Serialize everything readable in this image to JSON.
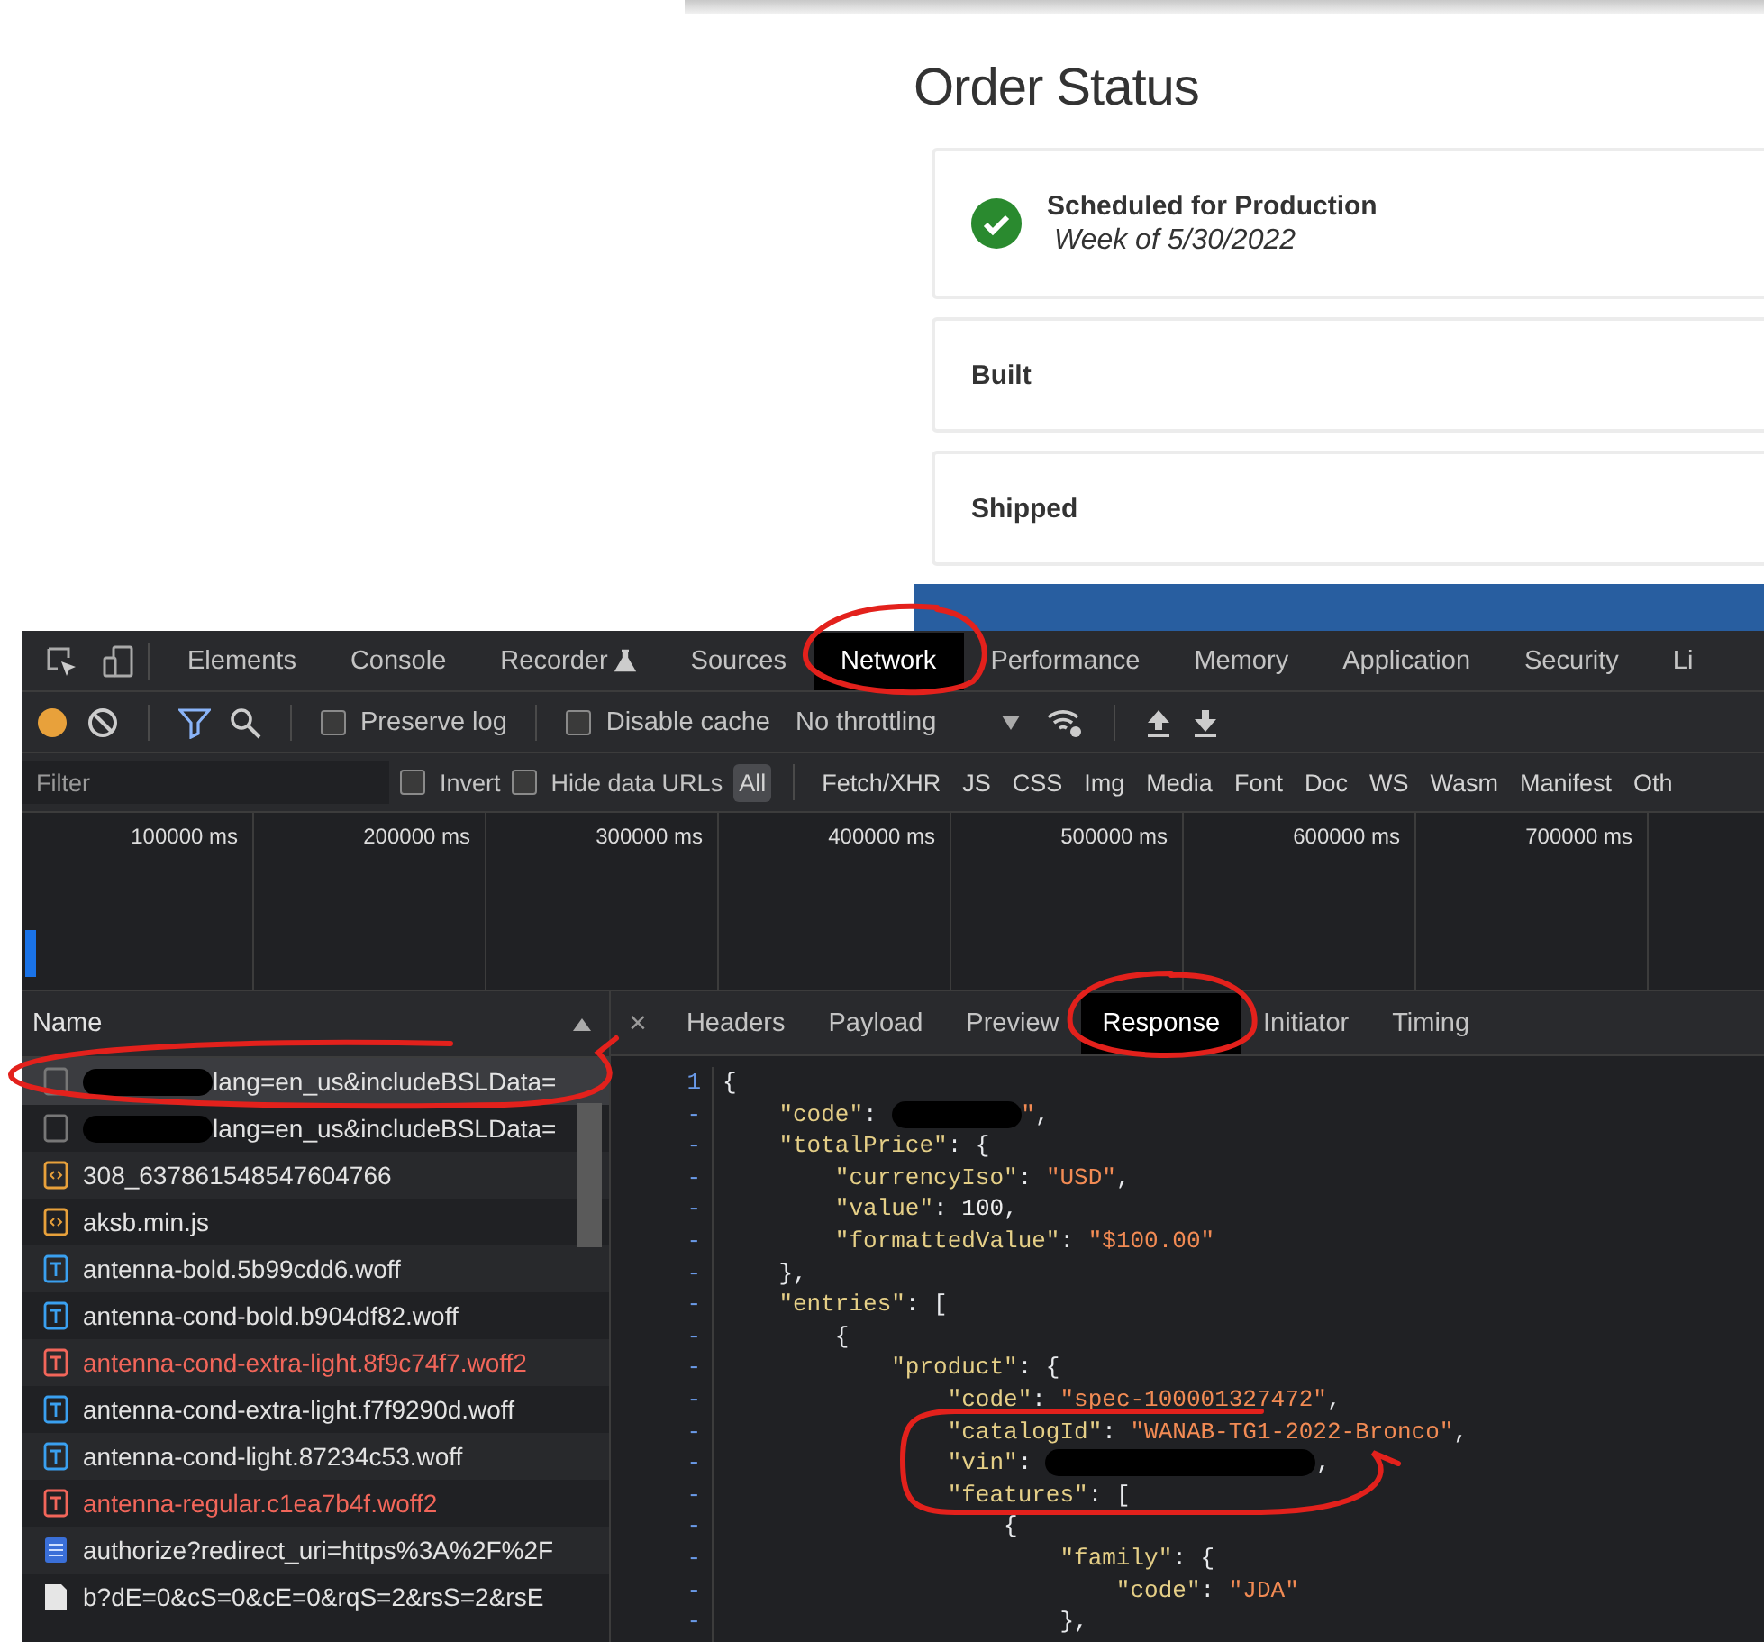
{
  "order_status": {
    "title": "Order Status",
    "steps": [
      {
        "label": "Scheduled for Production",
        "detail": "Week of 5/30/2022",
        "done": true
      },
      {
        "label": "Built",
        "done": false
      },
      {
        "label": "Shipped",
        "done": false
      }
    ]
  },
  "devtools": {
    "panels": [
      {
        "label": "Elements",
        "selected": false
      },
      {
        "label": "Console",
        "selected": false
      },
      {
        "label": "Recorder",
        "selected": false,
        "experimental": true
      },
      {
        "label": "Sources",
        "selected": false
      },
      {
        "label": "Network",
        "selected": true
      },
      {
        "label": "Performance",
        "selected": false
      },
      {
        "label": "Memory",
        "selected": false
      },
      {
        "label": "Application",
        "selected": false
      },
      {
        "label": "Security",
        "selected": false
      },
      {
        "label": "Li",
        "selected": false
      }
    ],
    "toolbar": {
      "preserve_log": {
        "label": "Preserve log",
        "checked": false
      },
      "disable_cache": {
        "label": "Disable cache",
        "checked": false
      },
      "throttling": "No throttling"
    },
    "filter": {
      "placeholder": "Filter",
      "invert": {
        "label": "Invert",
        "checked": false
      },
      "hide_data_urls": {
        "label": "Hide data URLs",
        "checked": false
      },
      "types": [
        {
          "label": "All",
          "selected": true
        },
        {
          "label": "Fetch/XHR",
          "selected": false
        },
        {
          "label": "JS",
          "selected": false
        },
        {
          "label": "CSS",
          "selected": false
        },
        {
          "label": "Img",
          "selected": false
        },
        {
          "label": "Media",
          "selected": false
        },
        {
          "label": "Font",
          "selected": false
        },
        {
          "label": "Doc",
          "selected": false
        },
        {
          "label": "WS",
          "selected": false
        },
        {
          "label": "Wasm",
          "selected": false
        },
        {
          "label": "Manifest",
          "selected": false
        },
        {
          "label": "Oth",
          "selected": false
        }
      ]
    },
    "timeline": [
      "100000 ms",
      "200000 ms",
      "300000 ms",
      "400000 ms",
      "500000 ms",
      "600000 ms",
      "700000 ms"
    ],
    "requests": {
      "column": "Name",
      "rows": [
        {
          "name": "lang=en_us&includeBSLData=",
          "kind": "blank",
          "redacted": true,
          "failed": false,
          "selected": true
        },
        {
          "name": "lang=en_us&includeBSLData=",
          "kind": "blank",
          "redacted": true,
          "failed": false,
          "selected": false
        },
        {
          "name": "308_637861548547604766",
          "kind": "script",
          "redacted": false,
          "failed": false,
          "selected": false
        },
        {
          "name": "aksb.min.js",
          "kind": "script",
          "redacted": false,
          "failed": false,
          "selected": false
        },
        {
          "name": "antenna-bold.5b99cdd6.woff",
          "kind": "font",
          "redacted": false,
          "failed": false,
          "selected": false
        },
        {
          "name": "antenna-cond-bold.b904df82.woff",
          "kind": "font",
          "redacted": false,
          "failed": false,
          "selected": false
        },
        {
          "name": "antenna-cond-extra-light.8f9c74f7.woff2",
          "kind": "font",
          "redacted": false,
          "failed": true,
          "selected": false
        },
        {
          "name": "antenna-cond-extra-light.f7f9290d.woff",
          "kind": "font",
          "redacted": false,
          "failed": false,
          "selected": false
        },
        {
          "name": "antenna-cond-light.87234c53.woff",
          "kind": "font",
          "redacted": false,
          "failed": false,
          "selected": false
        },
        {
          "name": "antenna-regular.c1ea7b4f.woff2",
          "kind": "font",
          "redacted": false,
          "failed": true,
          "selected": false
        },
        {
          "name": "authorize?redirect_uri=https%3A%2F%2F",
          "kind": "doc",
          "redacted": false,
          "failed": false,
          "selected": false
        },
        {
          "name": "b?dE=0&cS=0&cE=0&rqS=2&rsS=2&rsE",
          "kind": "image",
          "redacted": false,
          "failed": false,
          "selected": false
        }
      ]
    },
    "detail_close": "×",
    "detail_tabs": [
      {
        "label": "Headers",
        "selected": false
      },
      {
        "label": "Payload",
        "selected": false
      },
      {
        "label": "Preview",
        "selected": false
      },
      {
        "label": "Response",
        "selected": true
      },
      {
        "label": "Initiator",
        "selected": false
      },
      {
        "label": "Timing",
        "selected": false
      }
    ],
    "response": [
      {
        "number": "1",
        "tokens": [
          {
            "kind": "punct",
            "text": "{"
          }
        ]
      },
      {
        "number": "-",
        "tokens": [
          {
            "kind": "key",
            "text": "    \"code\""
          },
          {
            "kind": "punct",
            "text": ": "
          },
          {
            "kind": "redaction",
            "wide": false
          },
          {
            "kind": "string",
            "text": "\""
          },
          {
            "kind": "punct",
            "text": ","
          }
        ]
      },
      {
        "number": "-",
        "tokens": [
          {
            "kind": "key",
            "text": "    \"totalPrice\""
          },
          {
            "kind": "punct",
            "text": ": {"
          }
        ]
      },
      {
        "number": "-",
        "tokens": [
          {
            "kind": "key",
            "text": "        \"currencyIso\""
          },
          {
            "kind": "punct",
            "text": ": "
          },
          {
            "kind": "string",
            "text": "\"USD\""
          },
          {
            "kind": "punct",
            "text": ","
          }
        ]
      },
      {
        "number": "-",
        "tokens": [
          {
            "kind": "key",
            "text": "        \"value\""
          },
          {
            "kind": "punct",
            "text": ": "
          },
          {
            "kind": "number",
            "text": "100"
          },
          {
            "kind": "punct",
            "text": ","
          }
        ]
      },
      {
        "number": "-",
        "tokens": [
          {
            "kind": "key",
            "text": "        \"formattedValue\""
          },
          {
            "kind": "punct",
            "text": ": "
          },
          {
            "kind": "string",
            "text": "\"$100.00\""
          }
        ]
      },
      {
        "number": "-",
        "tokens": [
          {
            "kind": "punct",
            "text": "    },"
          }
        ]
      },
      {
        "number": "-",
        "tokens": [
          {
            "kind": "key",
            "text": "    \"entries\""
          },
          {
            "kind": "punct",
            "text": ": ["
          }
        ]
      },
      {
        "number": "-",
        "tokens": [
          {
            "kind": "punct",
            "text": "        {"
          }
        ]
      },
      {
        "number": "-",
        "tokens": [
          {
            "kind": "key",
            "text": "            \"product\""
          },
          {
            "kind": "punct",
            "text": ": {"
          }
        ]
      },
      {
        "number": "-",
        "tokens": [
          {
            "kind": "key",
            "text": "                \"code\""
          },
          {
            "kind": "punct",
            "text": ": "
          },
          {
            "kind": "string",
            "text": "\"spec-100001327472\""
          },
          {
            "kind": "punct",
            "text": ","
          }
        ]
      },
      {
        "number": "-",
        "tokens": [
          {
            "kind": "key",
            "text": "                \"catalogId\""
          },
          {
            "kind": "punct",
            "text": ": "
          },
          {
            "kind": "string",
            "text": "\"WANAB-TG1-2022-Bronco\""
          },
          {
            "kind": "punct",
            "text": ","
          }
        ]
      },
      {
        "number": "-",
        "tokens": [
          {
            "kind": "key",
            "text": "                \"vin\""
          },
          {
            "kind": "punct",
            "text": ": "
          },
          {
            "kind": "redaction",
            "wide": true
          },
          {
            "kind": "punct",
            "text": ","
          }
        ]
      },
      {
        "number": "-",
        "tokens": [
          {
            "kind": "key",
            "text": "                \"features\""
          },
          {
            "kind": "punct",
            "text": ": ["
          }
        ]
      },
      {
        "number": "-",
        "tokens": [
          {
            "kind": "punct",
            "text": "                    {"
          }
        ]
      },
      {
        "number": "-",
        "tokens": [
          {
            "kind": "key",
            "text": "                        \"family\""
          },
          {
            "kind": "punct",
            "text": ": {"
          }
        ]
      },
      {
        "number": "-",
        "tokens": [
          {
            "kind": "key",
            "text": "                            \"code\""
          },
          {
            "kind": "punct",
            "text": ": "
          },
          {
            "kind": "string",
            "text": "\"JDA\""
          }
        ]
      },
      {
        "number": "-",
        "tokens": [
          {
            "kind": "punct",
            "text": "                        },"
          }
        ]
      }
    ]
  },
  "annotations": [
    {
      "kind": "ellipse"
    },
    {
      "kind": "ellipse"
    },
    {
      "kind": "ellipse"
    },
    {
      "kind": "ellipse"
    }
  ]
}
